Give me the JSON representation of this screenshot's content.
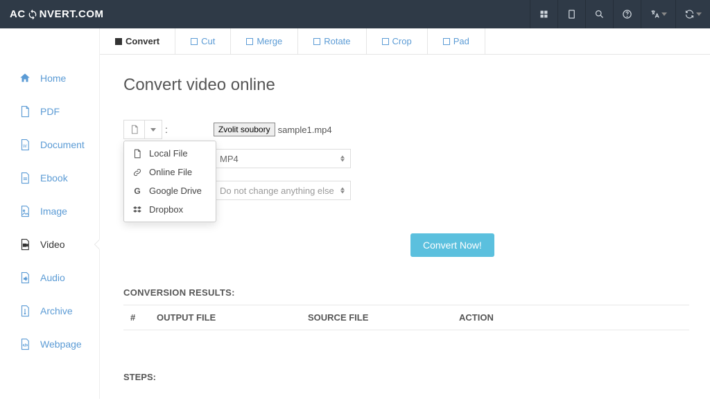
{
  "header": {
    "logo_prefix": "AC",
    "logo_suffix": "NVERT.COM"
  },
  "sidebar": {
    "items": [
      {
        "label": "Home"
      },
      {
        "label": "PDF"
      },
      {
        "label": "Document"
      },
      {
        "label": "Ebook"
      },
      {
        "label": "Image"
      },
      {
        "label": "Video"
      },
      {
        "label": "Audio"
      },
      {
        "label": "Archive"
      },
      {
        "label": "Webpage"
      }
    ]
  },
  "tabs": [
    {
      "label": "Convert"
    },
    {
      "label": "Cut"
    },
    {
      "label": "Merge"
    },
    {
      "label": "Rotate"
    },
    {
      "label": "Crop"
    },
    {
      "label": "Pad"
    }
  ],
  "page": {
    "title": "Convert video online"
  },
  "form": {
    "colon": ":",
    "file_button": "Zvolit soubory",
    "file_name": "sample1.mp4",
    "target_format": "MP4",
    "options_value": "Do not change anything else",
    "convert_button": "Convert Now!"
  },
  "dropdown": {
    "items": [
      {
        "label": "Local File"
      },
      {
        "label": "Online File"
      },
      {
        "label": "Google Drive"
      },
      {
        "label": "Dropbox"
      }
    ]
  },
  "results": {
    "heading": "CONVERSION RESULTS:",
    "col_num": "#",
    "col_output": "OUTPUT FILE",
    "col_source": "SOURCE FILE",
    "col_action": "ACTION"
  },
  "steps": {
    "heading": "STEPS:"
  }
}
